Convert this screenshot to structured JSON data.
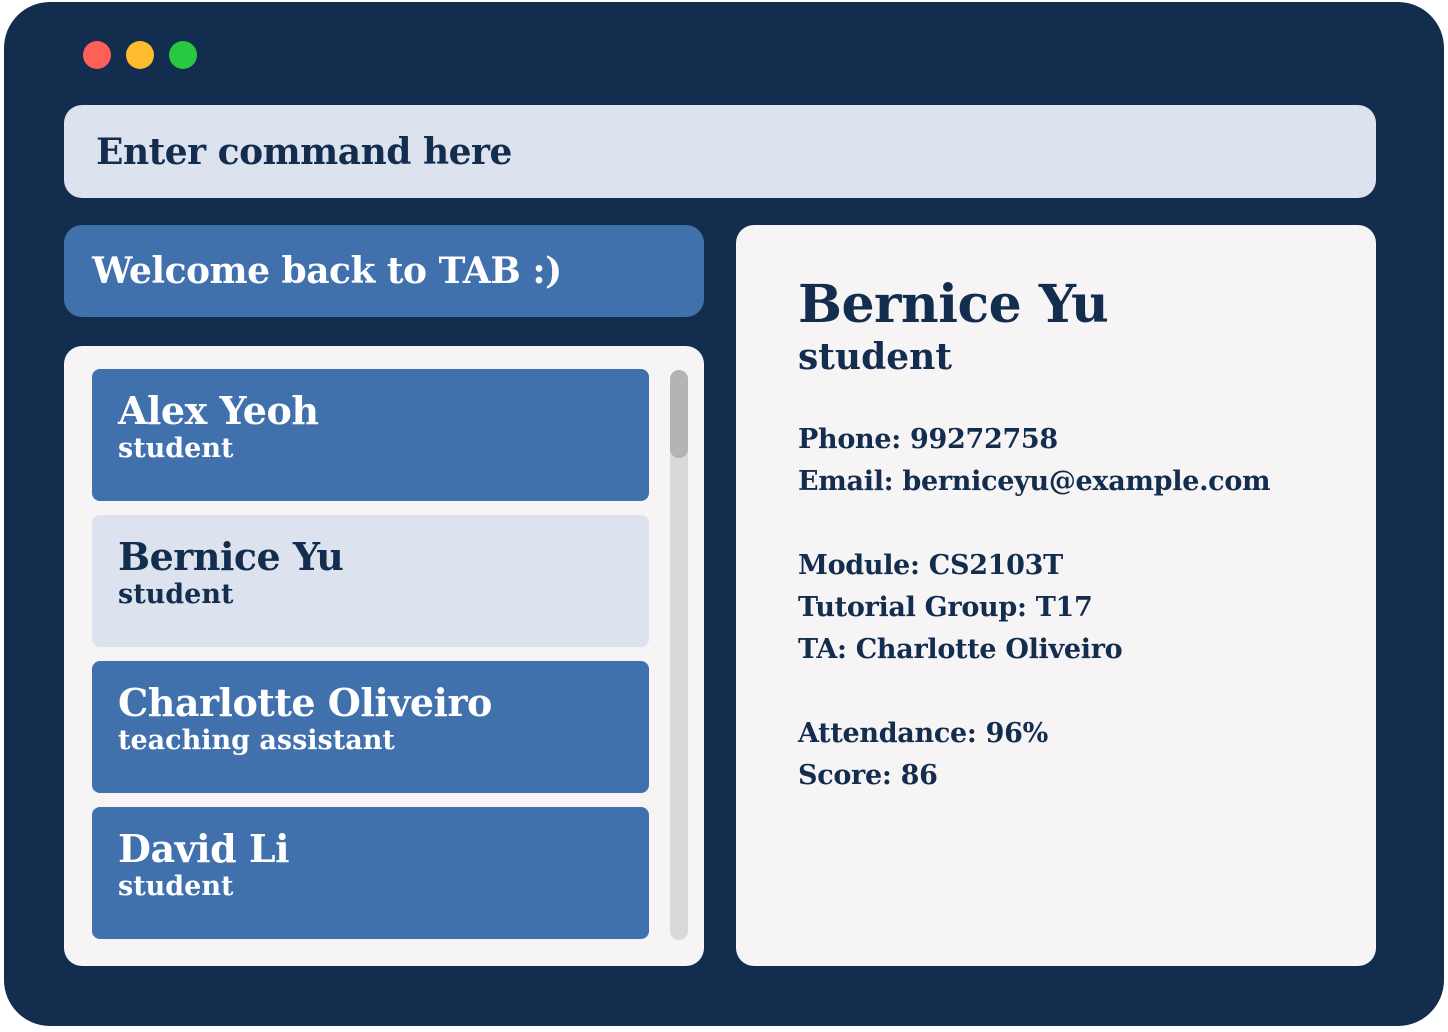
{
  "window": {
    "controls": [
      "close",
      "minimize",
      "maximize"
    ],
    "colors": {
      "background": "#132d4f",
      "close": "#fe5f57",
      "minimize": "#febc2e",
      "maximize": "#28c840"
    }
  },
  "command": {
    "placeholder": "Enter command here",
    "value": ""
  },
  "welcome": {
    "text": "Welcome back to TAB :)"
  },
  "list": {
    "items": [
      {
        "name": "Alex Yeoh",
        "role": "student",
        "selected": false
      },
      {
        "name": "Bernice Yu",
        "role": "student",
        "selected": true
      },
      {
        "name": "Charlotte Oliveiro",
        "role": "teaching assistant",
        "selected": false
      },
      {
        "name": "David Li",
        "role": "student",
        "selected": false
      }
    ]
  },
  "detail": {
    "name": "Bernice Yu",
    "role": "student",
    "phone": "Phone: 99272758",
    "email": "Email: berniceyu@example.com",
    "module": "Module: CS2103T",
    "tutorial_group": "Tutorial Group: T17",
    "ta": "TA: Charlotte Oliveiro",
    "attendance": "Attendance: 96%",
    "score": "Score: 86"
  },
  "colors": {
    "accent": "#4171ad",
    "selected": "#dce2ee",
    "panel": "#f7f4f5",
    "text_dark": "#132d4f"
  }
}
